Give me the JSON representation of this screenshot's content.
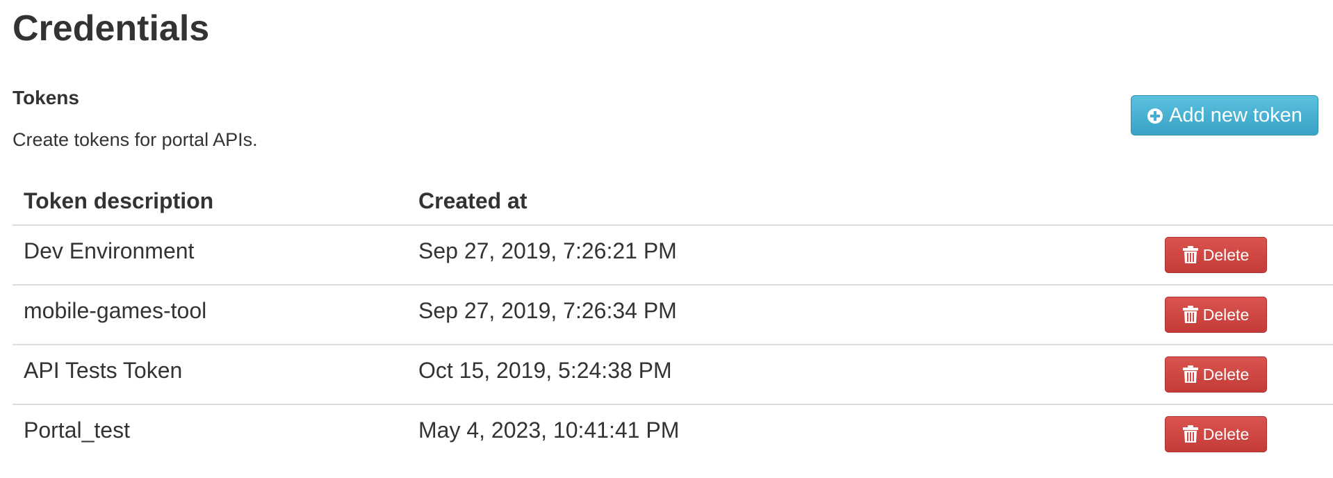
{
  "page": {
    "title": "Credentials"
  },
  "tokens_section": {
    "title": "Tokens",
    "description": "Create tokens for portal APIs.",
    "add_button_label": "Add new token",
    "add_button_icon": "plus-circle-icon"
  },
  "table": {
    "headers": [
      "Token description",
      "Created at",
      ""
    ],
    "rows": [
      {
        "description": "Dev Environment",
        "created_at": "Sep 27, 2019, 7:26:21 PM",
        "action_label": "Delete"
      },
      {
        "description": "mobile-games-tool",
        "created_at": "Sep 27, 2019, 7:26:34 PM",
        "action_label": "Delete"
      },
      {
        "description": "API Tests Token",
        "created_at": "Oct 15, 2019, 5:24:38 PM",
        "action_label": "Delete"
      },
      {
        "description": "Portal_test",
        "created_at": "May 4, 2023, 10:41:41 PM",
        "action_label": "Delete"
      }
    ],
    "delete_icon": "trash-icon"
  },
  "colors": {
    "add_button": "#46b8da",
    "delete_button": "#d9534f",
    "text": "#333333",
    "divider": "#dddddd"
  }
}
